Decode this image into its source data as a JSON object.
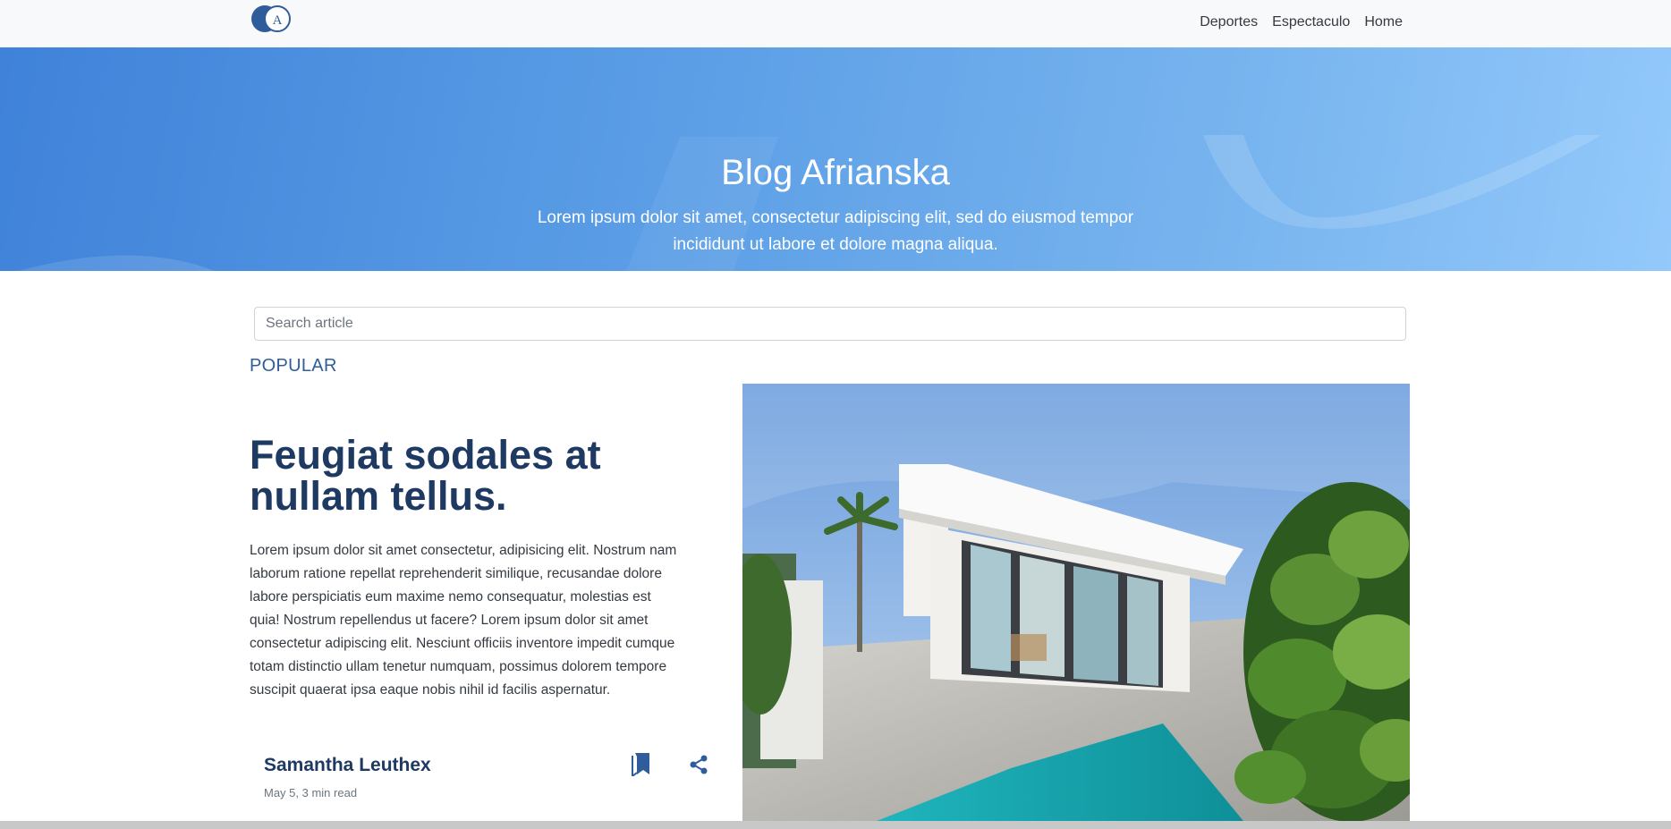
{
  "navbar": {
    "logo_letter": "A",
    "links": [
      "Deportes",
      "Espectaculo",
      "Home"
    ]
  },
  "hero": {
    "title": "Blog Afrianska",
    "subtitle": "Lorem ipsum dolor sit amet, consectetur adipiscing elit, sed do eiusmod tempor incididunt ut labore et dolore magna aliqua."
  },
  "search": {
    "placeholder": "Search article",
    "value": ""
  },
  "popular": {
    "label": "POPULAR"
  },
  "article": {
    "title": "Feugiat sodales at nullam tellus.",
    "excerpt": "Lorem ipsum dolor sit amet consectetur, adipisicing elit. Nostrum nam laborum ratione repellat reprehenderit similique, recusandae dolore labore perspiciatis eum maxime nemo consequatur, molestias est quia! Nostrum repellendus ut facere? Lorem ipsum dolor sit amet consectetur adipiscing elit. Nesciunt officiis inventore impedit cumque totam distinctio ullam tenetur numquam, possimus dolorem tempore suscipit quaerat ipsa eaque nobis nihil id facilis aspernatur.",
    "author": "Samantha Leuthex",
    "meta": "May 5, 3 min read",
    "image_icon": "modern-house-photo",
    "actions": [
      "bookmark-icon",
      "share-icon"
    ]
  },
  "colors": {
    "brand_dark": "#1e3a62",
    "accent": "#2f5d9c",
    "hero_start": "#3f82d9",
    "hero_end": "#93c9fb"
  }
}
